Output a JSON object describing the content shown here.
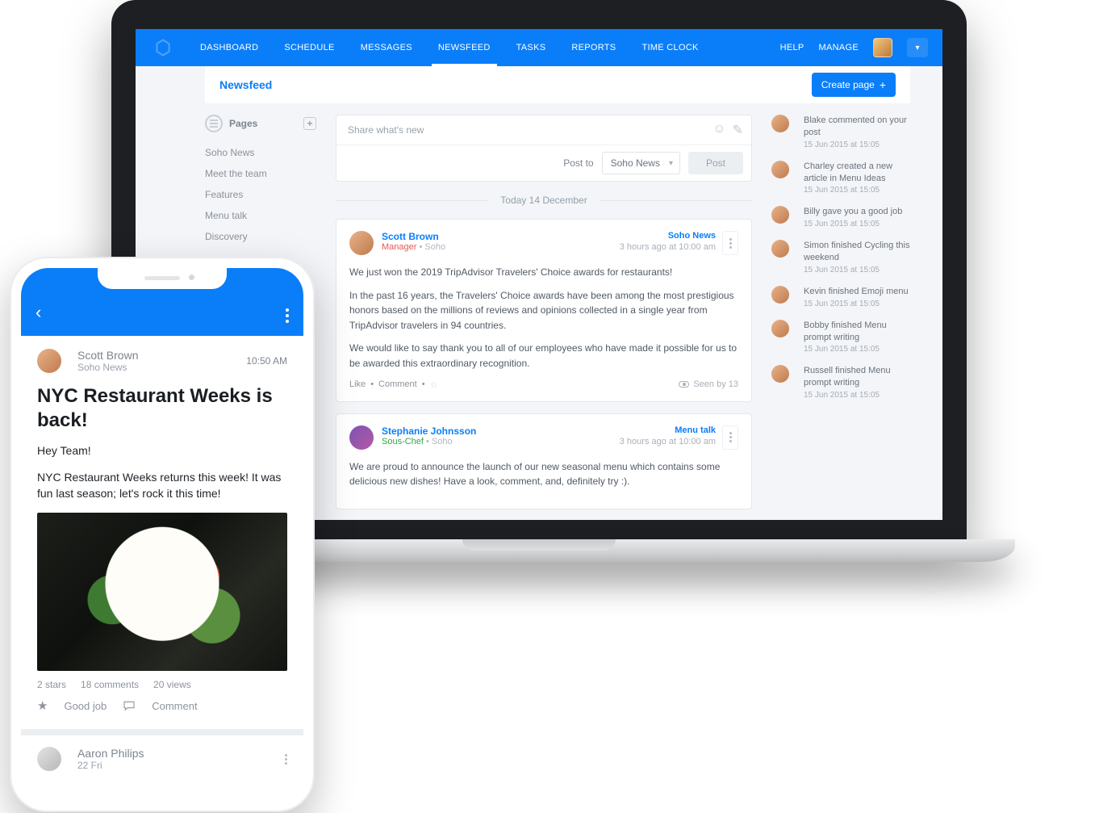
{
  "nav": {
    "items": [
      "DASHBOARD",
      "SCHEDULE",
      "MESSAGES",
      "NEWSFEED",
      "TASKS",
      "REPORTS",
      "TIME CLOCK"
    ],
    "right": {
      "help": "HELP",
      "manage": "MANAGE"
    }
  },
  "header": {
    "title": "Newsfeed",
    "create_btn": "Create page"
  },
  "sidebar": {
    "heading": "Pages",
    "items": [
      "Soho News",
      "Meet the team",
      "Features",
      "Menu talk",
      "Discovery"
    ]
  },
  "composer": {
    "placeholder": "Share what's new",
    "post_to_label": "Post to",
    "selected": "Soho News",
    "post_btn": "Post"
  },
  "divider": "Today 14 December",
  "posts": [
    {
      "author": "Scott Brown",
      "role": "Manager",
      "org": "Soho",
      "category": "Soho News",
      "time": "3 hours ago at 10:00 am",
      "paras": [
        "We just won the 2019 TripAdvisor Travelers' Choice awards for restaurants!",
        "In the past 16 years, the Travelers' Choice awards have been among the most prestigious honors based on the millions of reviews and opinions collected in a single year from TripAdvisor travelers in 94 countries.",
        "We would like to say thank you to all of our employees who have made it possible for us to be awarded this extraordinary recognition."
      ],
      "like": "Like",
      "comment": "Comment",
      "seen": "Seen by 13"
    },
    {
      "author": "Stephanie Johnsson",
      "role": "Sous-Chef",
      "org": "Soho",
      "category": "Menu talk",
      "time": "3 hours ago at 10:00 am",
      "paras": [
        "We are proud to announce the launch of our new seasonal menu which contains some delicious new dishes! Have a look, comment, and, definitely try :)."
      ]
    }
  ],
  "activity": [
    {
      "text": "Blake commented on your post",
      "time": "15 Jun 2015 at 15:05"
    },
    {
      "text": "Charley created a new article in Menu Ideas",
      "time": "15 Jun 2015 at 15:05"
    },
    {
      "text": "Billy gave you a good job",
      "time": "15 Jun 2015 at 15:05"
    },
    {
      "text": "Simon finished Cycling this weekend",
      "time": "15 Jun 2015 at 15:05"
    },
    {
      "text": "Kevin finished Emoji menu",
      "time": "15 Jun 2015 at 15:05"
    },
    {
      "text": "Bobby finished Menu prompt writing",
      "time": "15 Jun 2015 at 15:05"
    },
    {
      "text": "Russell finished Menu prompt writing",
      "time": "15 Jun 2015 at 15:05"
    }
  ],
  "mobile": {
    "post1": {
      "author": "Scott Brown",
      "category": "Soho News",
      "time": "10:50 AM",
      "title": "NYC Restaurant Weeks is back!",
      "greeting": "Hey Team!",
      "para": "NYC Restaurant Weeks returns this week! It was fun last season; let's rock it this time!",
      "stats": {
        "stars": "2 stars",
        "comments": "18 comments",
        "views": "20 views"
      },
      "actions": {
        "goodjob": "Good job",
        "comment": "Comment"
      }
    },
    "post2": {
      "author": "Aaron Philips",
      "date": "22 Fri"
    }
  }
}
